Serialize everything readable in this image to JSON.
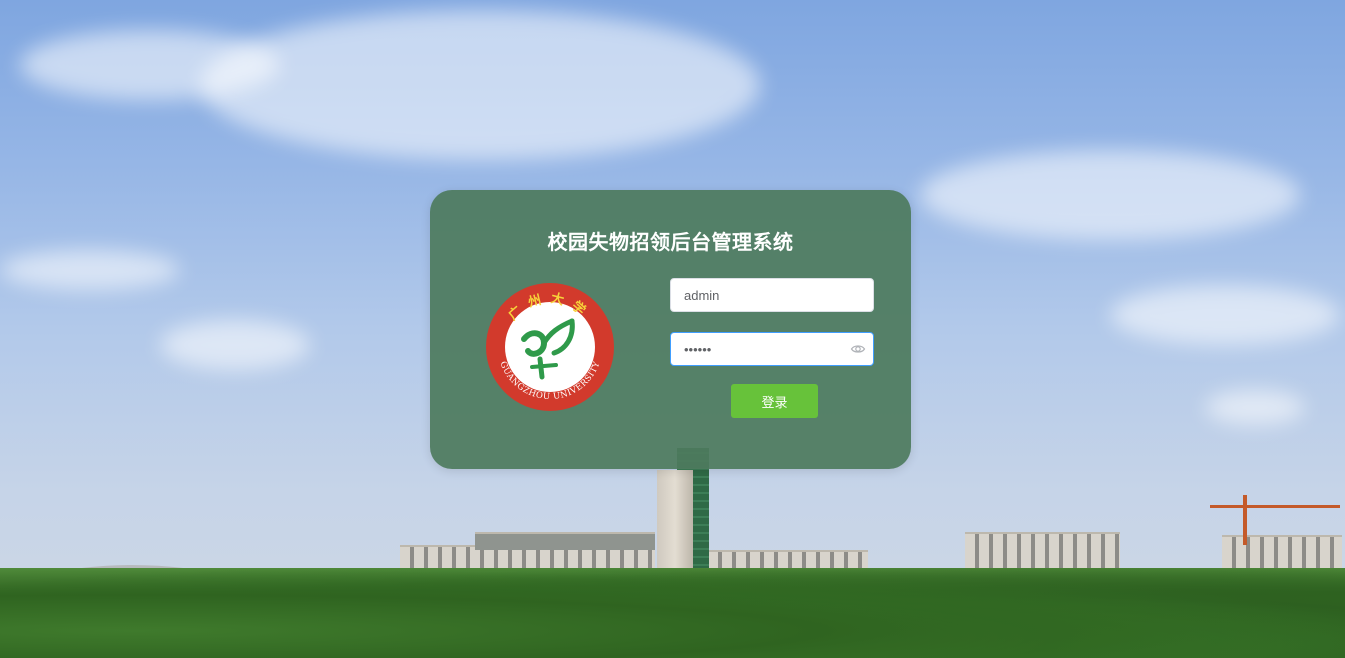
{
  "login": {
    "title": "校园失物招领后台管理系统",
    "username_value": "admin",
    "password_value": "••••••",
    "login_button": "登录"
  },
  "logo": {
    "text_top": "广州大学",
    "text_bottom": "GUANGZHOU UNIVERSITY",
    "ring_color": "#d23a2c",
    "emblem_color": "#2f9a4a"
  },
  "colors": {
    "card_bg": "#4e7b5e",
    "button_bg": "#67c23a",
    "focus_border": "#409eff"
  },
  "icons": {
    "password_toggle": "eye-icon"
  }
}
